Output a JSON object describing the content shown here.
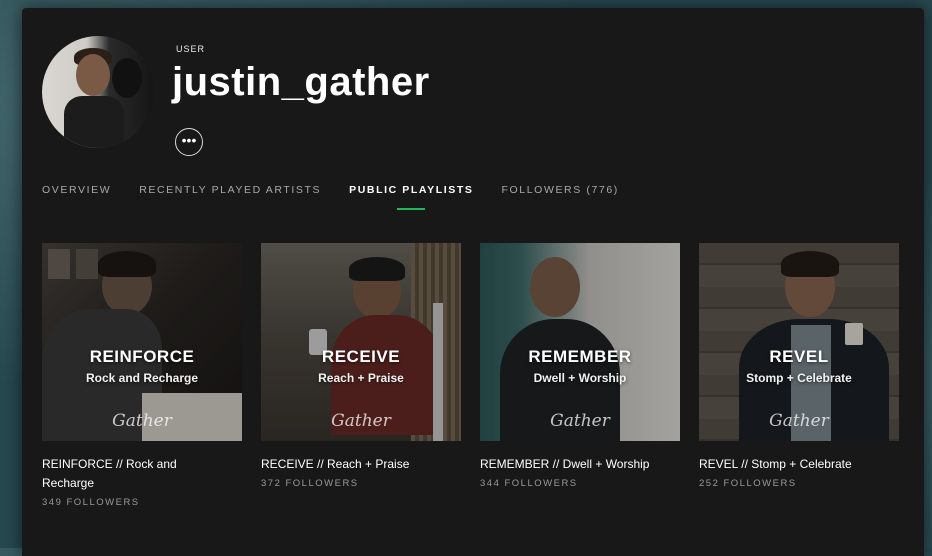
{
  "profile": {
    "type_label": "USER",
    "username": "justin_gather",
    "more_label": "•••"
  },
  "tabs": [
    {
      "label": "OVERVIEW",
      "active": false
    },
    {
      "label": "RECENTLY PLAYED ARTISTS",
      "active": false
    },
    {
      "label": "PUBLIC PLAYLISTS",
      "active": true
    },
    {
      "label": "FOLLOWERS (776)",
      "active": false
    }
  ],
  "playlists": [
    {
      "cover_title": "REINFORCE",
      "cover_subtitle": "Rock and Recharge",
      "cover_signature": "Gather",
      "title": "REINFORCE // Rock and Recharge",
      "followers": "349 FOLLOWERS"
    },
    {
      "cover_title": "RECEIVE",
      "cover_subtitle": "Reach + Praise",
      "cover_signature": "Gather",
      "title": "RECEIVE // Reach + Praise",
      "followers": "372 FOLLOWERS"
    },
    {
      "cover_title": "REMEMBER",
      "cover_subtitle": "Dwell + Worship",
      "cover_signature": "Gather",
      "title": "REMEMBER // Dwell + Worship",
      "followers": "344 FOLLOWERS"
    },
    {
      "cover_title": "REVEL",
      "cover_subtitle": "Stomp + Celebrate",
      "cover_signature": "Gather",
      "title": "REVEL // Stomp + Celebrate",
      "followers": "252 FOLLOWERS"
    }
  ],
  "colors": {
    "accent": "#1db954",
    "background": "#181818",
    "desktop": "#27484f"
  }
}
